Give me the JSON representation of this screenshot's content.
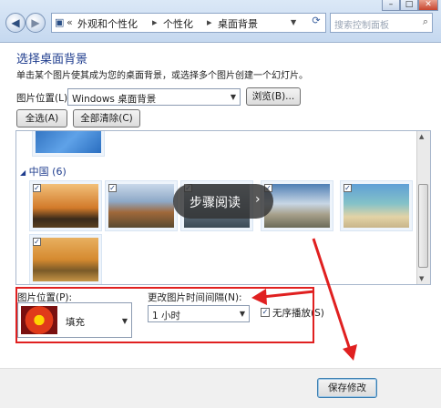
{
  "nav": {
    "back_icon": "back-arrow-icon",
    "forward_icon": "forward-arrow-icon",
    "breadcrumb": [
      "外观和个性化",
      "个性化",
      "桌面背景"
    ],
    "search_placeholder": "搜索控制面板"
  },
  "window_buttons": [
    "minimize-icon",
    "maximize-icon",
    "close-icon"
  ],
  "page": {
    "title": "选择桌面背景",
    "description": "单击某个图片使其成为您的桌面背景，或选择多个图片创建一个幻灯片。"
  },
  "picture_location": {
    "label": "图片位置(L):",
    "value": "Windows 桌面背景",
    "browse_label": "浏览(B)..."
  },
  "select_all_label": "全选(A)",
  "clear_all_label": "全部清除(C)",
  "gallery": {
    "group_name": "中国 (6)",
    "items_checked": [
      true,
      true,
      true,
      true,
      true,
      true
    ]
  },
  "overlay_label": "步骤阅读",
  "picture_position": {
    "label": "图片位置(P):",
    "value": "填充"
  },
  "interval": {
    "label": "更改图片时间间隔(N):",
    "value": "1 小时"
  },
  "shuffle": {
    "label": "无序播放(S)",
    "checked": true
  },
  "footer": {
    "save_label": "保存修改"
  },
  "colors": {
    "annotation": "#e02020",
    "heading": "#1f3d8e"
  }
}
